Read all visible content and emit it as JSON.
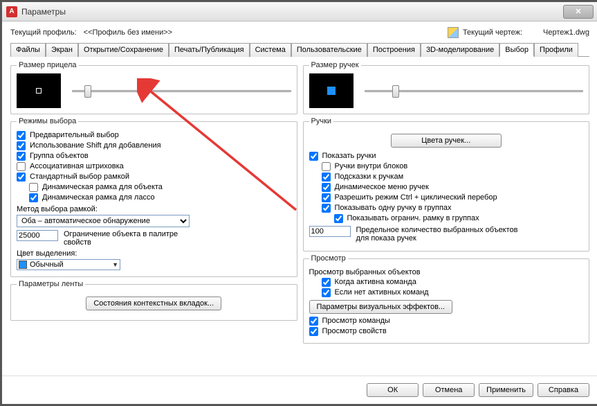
{
  "window": {
    "title": "Параметры"
  },
  "profile": {
    "label": "Текущий профиль:",
    "name": "<<Профиль без имени>>",
    "drawing_label": "Текущий чертеж:",
    "drawing_name": "Чертеж1.dwg"
  },
  "tabs": [
    "Файлы",
    "Экран",
    "Открытие/Сохранение",
    "Печать/Публикация",
    "Система",
    "Пользовательские",
    "Построения",
    "3D-моделирование",
    "Выбор",
    "Профили"
  ],
  "active_tab": "Выбор",
  "left": {
    "pickbox": {
      "legend": "Размер прицела"
    },
    "selection_modes": {
      "legend": "Режимы выбора",
      "items": [
        {
          "label": "Предварительный выбор",
          "checked": true
        },
        {
          "label": "Использование Shift для добавления",
          "checked": true
        },
        {
          "label": "Группа объектов",
          "checked": true
        },
        {
          "label": "Ассоциативная штриховка",
          "checked": false
        },
        {
          "label": "Стандартный выбор рамкой",
          "checked": true
        },
        {
          "label": "Динамическая рамка для объекта",
          "checked": false,
          "indent": 1
        },
        {
          "label": "Динамическая рамка для лассо",
          "checked": true,
          "indent": 1
        }
      ],
      "window_method_label": "Метод выбора рамкой:",
      "window_method_value": "Оба – автоматическое обнаружение",
      "limit_value": "25000",
      "limit_label": "Ограничение объекта в палитре свойств",
      "highlight_label": "Цвет выделения:",
      "highlight_value": "Обычный"
    },
    "ribbon": {
      "legend": "Параметры ленты",
      "button": "Состояния контекстных вкладок..."
    }
  },
  "right": {
    "gripsize": {
      "legend": "Размер ручек"
    },
    "grips": {
      "legend": "Ручки",
      "colors_btn": "Цвета ручек...",
      "items": [
        {
          "label": "Показать ручки",
          "checked": true
        },
        {
          "label": "Ручки внутри блоков",
          "checked": false,
          "indent": 1
        },
        {
          "label": "Подсказки к ручкам",
          "checked": true,
          "indent": 1
        },
        {
          "label": "Динамическое меню ручек",
          "checked": true,
          "indent": 1
        },
        {
          "label": "Разрешить режим Ctrl + циклический перебор",
          "checked": true,
          "indent": 1
        },
        {
          "label": "Показывать одну ручку в группах",
          "checked": true,
          "indent": 1
        },
        {
          "label": "Показывать огранич. рамку в группах",
          "checked": true,
          "indent": 2
        }
      ],
      "limit_value": "100",
      "limit_label": "Предельное количество выбранных объектов для показа ручек"
    },
    "preview": {
      "legend": "Просмотр",
      "sub1": "Просмотр выбранных объектов",
      "chk_cmd_active": {
        "label": "Когда активна команда",
        "checked": true
      },
      "chk_no_cmd": {
        "label": "Если нет активных команд",
        "checked": true
      },
      "effects_btn": "Параметры визуальных эффектов...",
      "chk_cmd_preview": {
        "label": "Просмотр команды",
        "checked": true
      },
      "chk_prop_preview": {
        "label": "Просмотр свойств",
        "checked": true
      }
    }
  },
  "footer": {
    "ok": "ОК",
    "cancel": "Отмена",
    "apply": "Применить",
    "help": "Справка"
  }
}
